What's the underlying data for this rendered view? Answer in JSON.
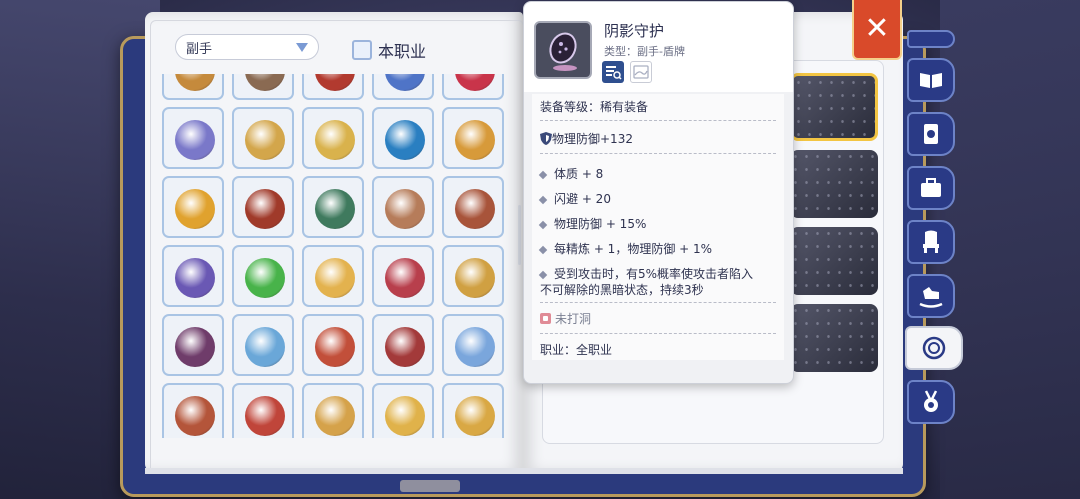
{
  "filter": {
    "category_label": "副手",
    "class_only_label": "本职业",
    "class_only_checked": false
  },
  "tooltip": {
    "name": "阴影守护",
    "type_line": "类型：副手-盾牌",
    "equip_level": "装备等级：稀有装备",
    "base_stat": "物理防御+132",
    "bonuses": [
      "体质 + 8",
      "闪避 + 20",
      "物理防御 + 15%",
      "每精炼 + 1，物理防御 + 1%"
    ],
    "effect_line1": "受到攻击时，有5%概率使攻击者陷入",
    "effect_line2": "不可解除的黑暗状态，持续3秒",
    "socket_status": "未打洞",
    "job": "职业：全职业"
  },
  "icons": {
    "close": "close-icon",
    "tabs": [
      "book-open-icon",
      "card-icon",
      "toolbox-icon",
      "throne-icon",
      "rocking-horse-icon",
      "headwear-icon",
      "medal-icon"
    ],
    "tooltip_buttons": [
      "compare-icon",
      "preview-icon"
    ]
  },
  "colors": {
    "accent_blue": "#2a3a86",
    "close_red": "#d94a2a",
    "selected_gold": "#f3c543",
    "slot_border": "#a9c4e4"
  },
  "grid_items": [
    {
      "icon": "shield-icon",
      "color": "#c58a3c"
    },
    {
      "icon": "barrel-icon",
      "color": "#8a6a52"
    },
    {
      "icon": "red-book-icon",
      "color": "#b23a2f"
    },
    {
      "icon": "blue-emblem-icon",
      "color": "#4f74c7"
    },
    {
      "icon": "red-bag-icon",
      "color": "#c9344a"
    },
    {
      "icon": "spellbook-icon",
      "color": "#7a78c9"
    },
    {
      "icon": "gold-shield-icon",
      "color": "#d3a64b"
    },
    {
      "icon": "wing-shield-icon",
      "color": "#d9b24c"
    },
    {
      "icon": "blue-vortex-icon",
      "color": "#2a7fc1"
    },
    {
      "icon": "gold-crest-icon",
      "color": "#d79a3a"
    },
    {
      "icon": "eye-emblem-icon",
      "color": "#e0a22e"
    },
    {
      "icon": "dragon-shield-icon",
      "color": "#a03a2a"
    },
    {
      "icon": "green-tome-icon",
      "color": "#3f7a5e"
    },
    {
      "icon": "round-shield-icon",
      "color": "#b67c5a"
    },
    {
      "icon": "armored-shield-icon",
      "color": "#a8543a"
    },
    {
      "icon": "dark-tome-icon",
      "color": "#6a58b4"
    },
    {
      "icon": "green-orb-icon",
      "color": "#48b34a"
    },
    {
      "icon": "cross-icon",
      "color": "#e3b24e"
    },
    {
      "icon": "jeweled-ring-icon",
      "color": "#b83f4c"
    },
    {
      "icon": "horn-icon",
      "color": "#d0a042"
    },
    {
      "icon": "claw-icon",
      "color": "#6f3c6a"
    },
    {
      "icon": "blue-bracelet-icon",
      "color": "#6aa7d8"
    },
    {
      "icon": "heart-ring-icon",
      "color": "#c24f3a"
    },
    {
      "icon": "red-bracelet-icon",
      "color": "#a33a3a"
    },
    {
      "icon": "crystal-shield-icon",
      "color": "#7aa6dc"
    },
    {
      "icon": "lantern-icon",
      "color": "#b4553a"
    },
    {
      "icon": "red-crystal-icon",
      "color": "#c0453a"
    },
    {
      "icon": "chalice-icon",
      "color": "#d5a24a"
    },
    {
      "icon": "candle-icon",
      "color": "#e0b24a"
    },
    {
      "icon": "gold-charm-icon",
      "color": "#d9a844"
    }
  ]
}
